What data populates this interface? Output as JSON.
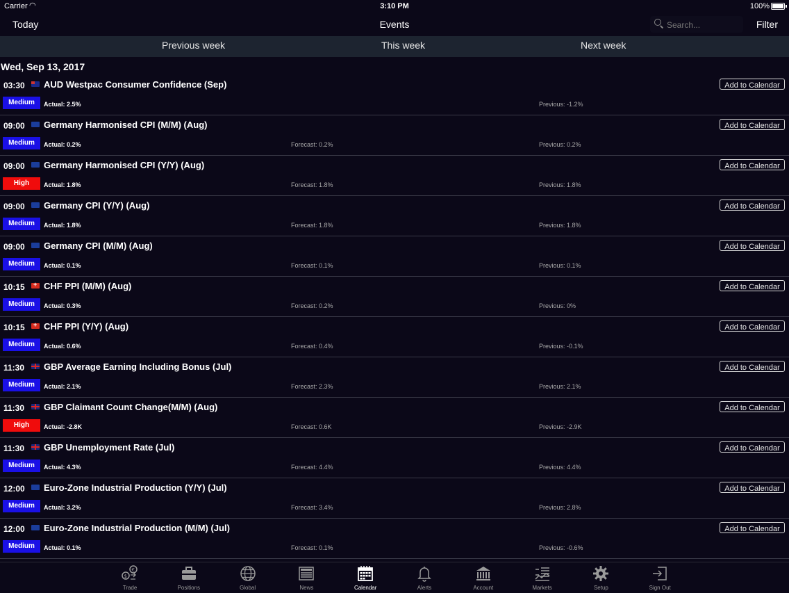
{
  "status_bar": {
    "carrier": "Carrier",
    "time": "3:10 PM",
    "battery": "100%"
  },
  "nav": {
    "today": "Today",
    "title": "Events",
    "search_placeholder": "Search...",
    "filter": "Filter"
  },
  "week": {
    "previous": "Previous week",
    "this": "This week",
    "next": "Next week"
  },
  "date_header": "Wed, Sep 13, 2017",
  "add_label": "Add to Calendar",
  "events": [
    {
      "time": "03:30",
      "flag": "au",
      "name": "AUD Westpac Consumer Confidence (Sep)",
      "impact": "Medium",
      "actual": "Actual: 2.5%",
      "forecast": "",
      "previous": "Previous: -1.2%"
    },
    {
      "time": "09:00",
      "flag": "eu",
      "name": "Germany Harmonised CPI (M/M) (Aug)",
      "impact": "Medium",
      "actual": "Actual: 0.2%",
      "forecast": "Forecast: 0.2%",
      "previous": "Previous: 0.2%"
    },
    {
      "time": "09:00",
      "flag": "eu",
      "name": "Germany Harmonised CPI (Y/Y) (Aug)",
      "impact": "High",
      "actual": "Actual: 1.8%",
      "forecast": "Forecast: 1.8%",
      "previous": "Previous: 1.8%"
    },
    {
      "time": "09:00",
      "flag": "eu",
      "name": "Germany CPI (Y/Y) (Aug)",
      "impact": "Medium",
      "actual": "Actual: 1.8%",
      "forecast": "Forecast: 1.8%",
      "previous": "Previous: 1.8%"
    },
    {
      "time": "09:00",
      "flag": "eu",
      "name": "Germany CPI (M/M) (Aug)",
      "impact": "Medium",
      "actual": "Actual: 0.1%",
      "forecast": "Forecast: 0.1%",
      "previous": "Previous: 0.1%"
    },
    {
      "time": "10:15",
      "flag": "ch",
      "name": "CHF PPI (M/M) (Aug)",
      "impact": "Medium",
      "actual": "Actual: 0.3%",
      "forecast": "Forecast: 0.2%",
      "previous": "Previous: 0%"
    },
    {
      "time": "10:15",
      "flag": "ch",
      "name": "CHF PPI (Y/Y) (Aug)",
      "impact": "Medium",
      "actual": "Actual: 0.6%",
      "forecast": "Forecast: 0.4%",
      "previous": "Previous: -0.1%"
    },
    {
      "time": "11:30",
      "flag": "gb",
      "name": "GBP Average Earning Including Bonus (Jul)",
      "impact": "Medium",
      "actual": "Actual: 2.1%",
      "forecast": "Forecast: 2.3%",
      "previous": "Previous: 2.1%"
    },
    {
      "time": "11:30",
      "flag": "gb",
      "name": "GBP Claimant Count Change(M/M) (Aug)",
      "impact": "High",
      "actual": "Actual: -2.8K",
      "forecast": "Forecast: 0.6K",
      "previous": "Previous: -2.9K"
    },
    {
      "time": "11:30",
      "flag": "gb",
      "name": "GBP Unemployment Rate (Jul)",
      "impact": "Medium",
      "actual": "Actual: 4.3%",
      "forecast": "Forecast: 4.4%",
      "previous": "Previous: 4.4%"
    },
    {
      "time": "12:00",
      "flag": "eu",
      "name": "Euro-Zone Industrial Production (Y/Y) (Jul)",
      "impact": "Medium",
      "actual": "Actual: 3.2%",
      "forecast": "Forecast: 3.4%",
      "previous": "Previous: 2.8%"
    },
    {
      "time": "12:00",
      "flag": "eu",
      "name": "Euro-Zone Industrial Production (M/M) (Jul)",
      "impact": "Medium",
      "actual": "Actual: 0.1%",
      "forecast": "Forecast: 0.1%",
      "previous": "Previous: -0.6%"
    }
  ],
  "tabs": [
    {
      "label": "Trade",
      "icon": "trade-icon",
      "active": false
    },
    {
      "label": "Positions",
      "icon": "briefcase-icon",
      "active": false
    },
    {
      "label": "Global",
      "icon": "globe-icon",
      "active": false
    },
    {
      "label": "News",
      "icon": "newspaper-icon",
      "active": false
    },
    {
      "label": "Calendar",
      "icon": "calendar-icon",
      "active": true
    },
    {
      "label": "Alerts",
      "icon": "bell-icon",
      "active": false
    },
    {
      "label": "Account",
      "icon": "bank-icon",
      "active": false
    },
    {
      "label": "Markets",
      "icon": "markets-icon",
      "active": false
    },
    {
      "label": "Setup",
      "icon": "gear-icon",
      "active": false
    },
    {
      "label": "Sign Out",
      "icon": "sign-out-icon",
      "active": false
    }
  ]
}
